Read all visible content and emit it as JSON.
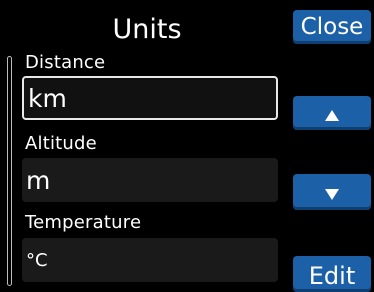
{
  "header": {
    "title": "Units"
  },
  "buttons": {
    "close": "Close",
    "edit": "Edit",
    "up_icon": "up-triangle",
    "down_icon": "down-triangle"
  },
  "fields": [
    {
      "label": "Distance",
      "value": "km",
      "selected": true
    },
    {
      "label": "Altitude",
      "value": "m",
      "selected": false
    },
    {
      "label": "Temperature",
      "value": "°C",
      "selected": false
    }
  ],
  "colors": {
    "background": "#000000",
    "button": "#1c61a8",
    "field": "#1a1a1a"
  }
}
